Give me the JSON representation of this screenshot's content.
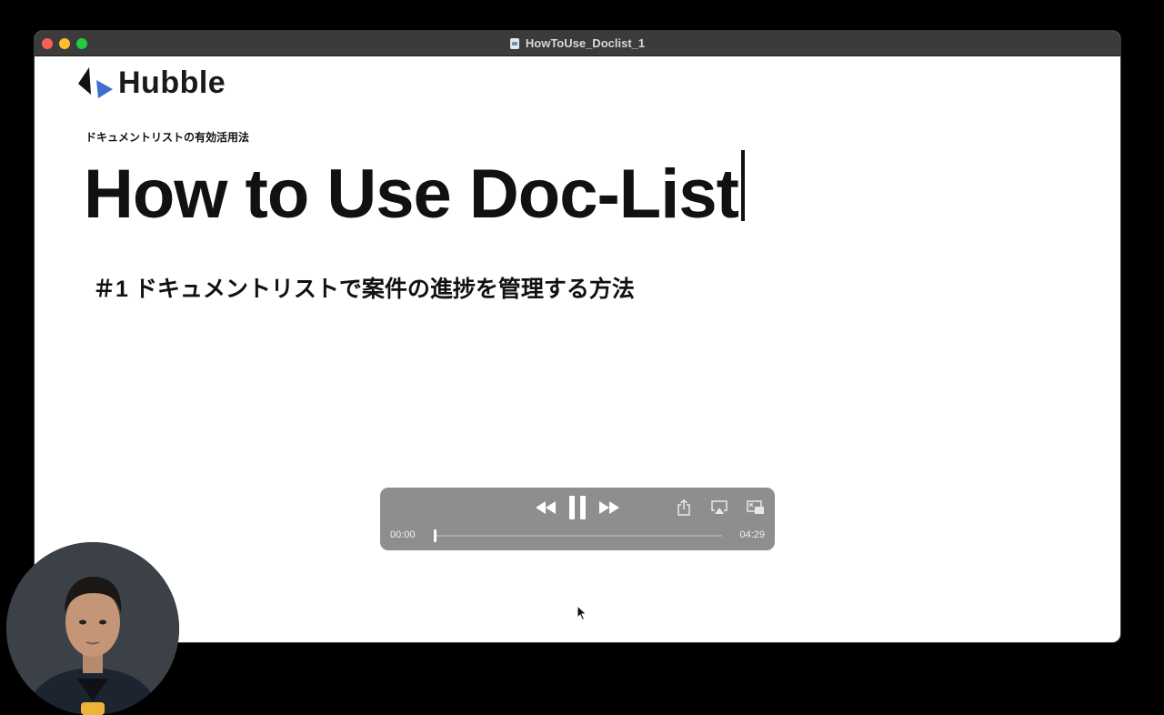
{
  "window": {
    "title": "HowToUse_Doclist_1"
  },
  "slide": {
    "logo_text": "Hubble",
    "subtitle_small": "ドキュメントリストの有効活用法",
    "main_title": "How to Use Doc-List",
    "episode_title": "＃1 ドキュメントリストで案件の進捗を管理する方法"
  },
  "player": {
    "current_time": "00:00",
    "total_time": "04:29",
    "progress": 0,
    "state": "playing"
  },
  "icons": {
    "close": "close-window-icon",
    "minimize": "minimize-window-icon",
    "zoom": "zoom-window-icon",
    "document": "document-icon",
    "rewind": "rewind-icon",
    "pause": "pause-icon",
    "fast_forward": "fast-forward-icon",
    "share": "share-icon",
    "airplay": "airplay-icon",
    "pip": "picture-in-picture-icon"
  },
  "colors": {
    "close": "#fe5f57",
    "minimize": "#febc2e",
    "zoom": "#28c840",
    "logo_blue": "#3d6fd1",
    "logo_dark": "#111111",
    "controls_bg": "#8e8e8e"
  }
}
